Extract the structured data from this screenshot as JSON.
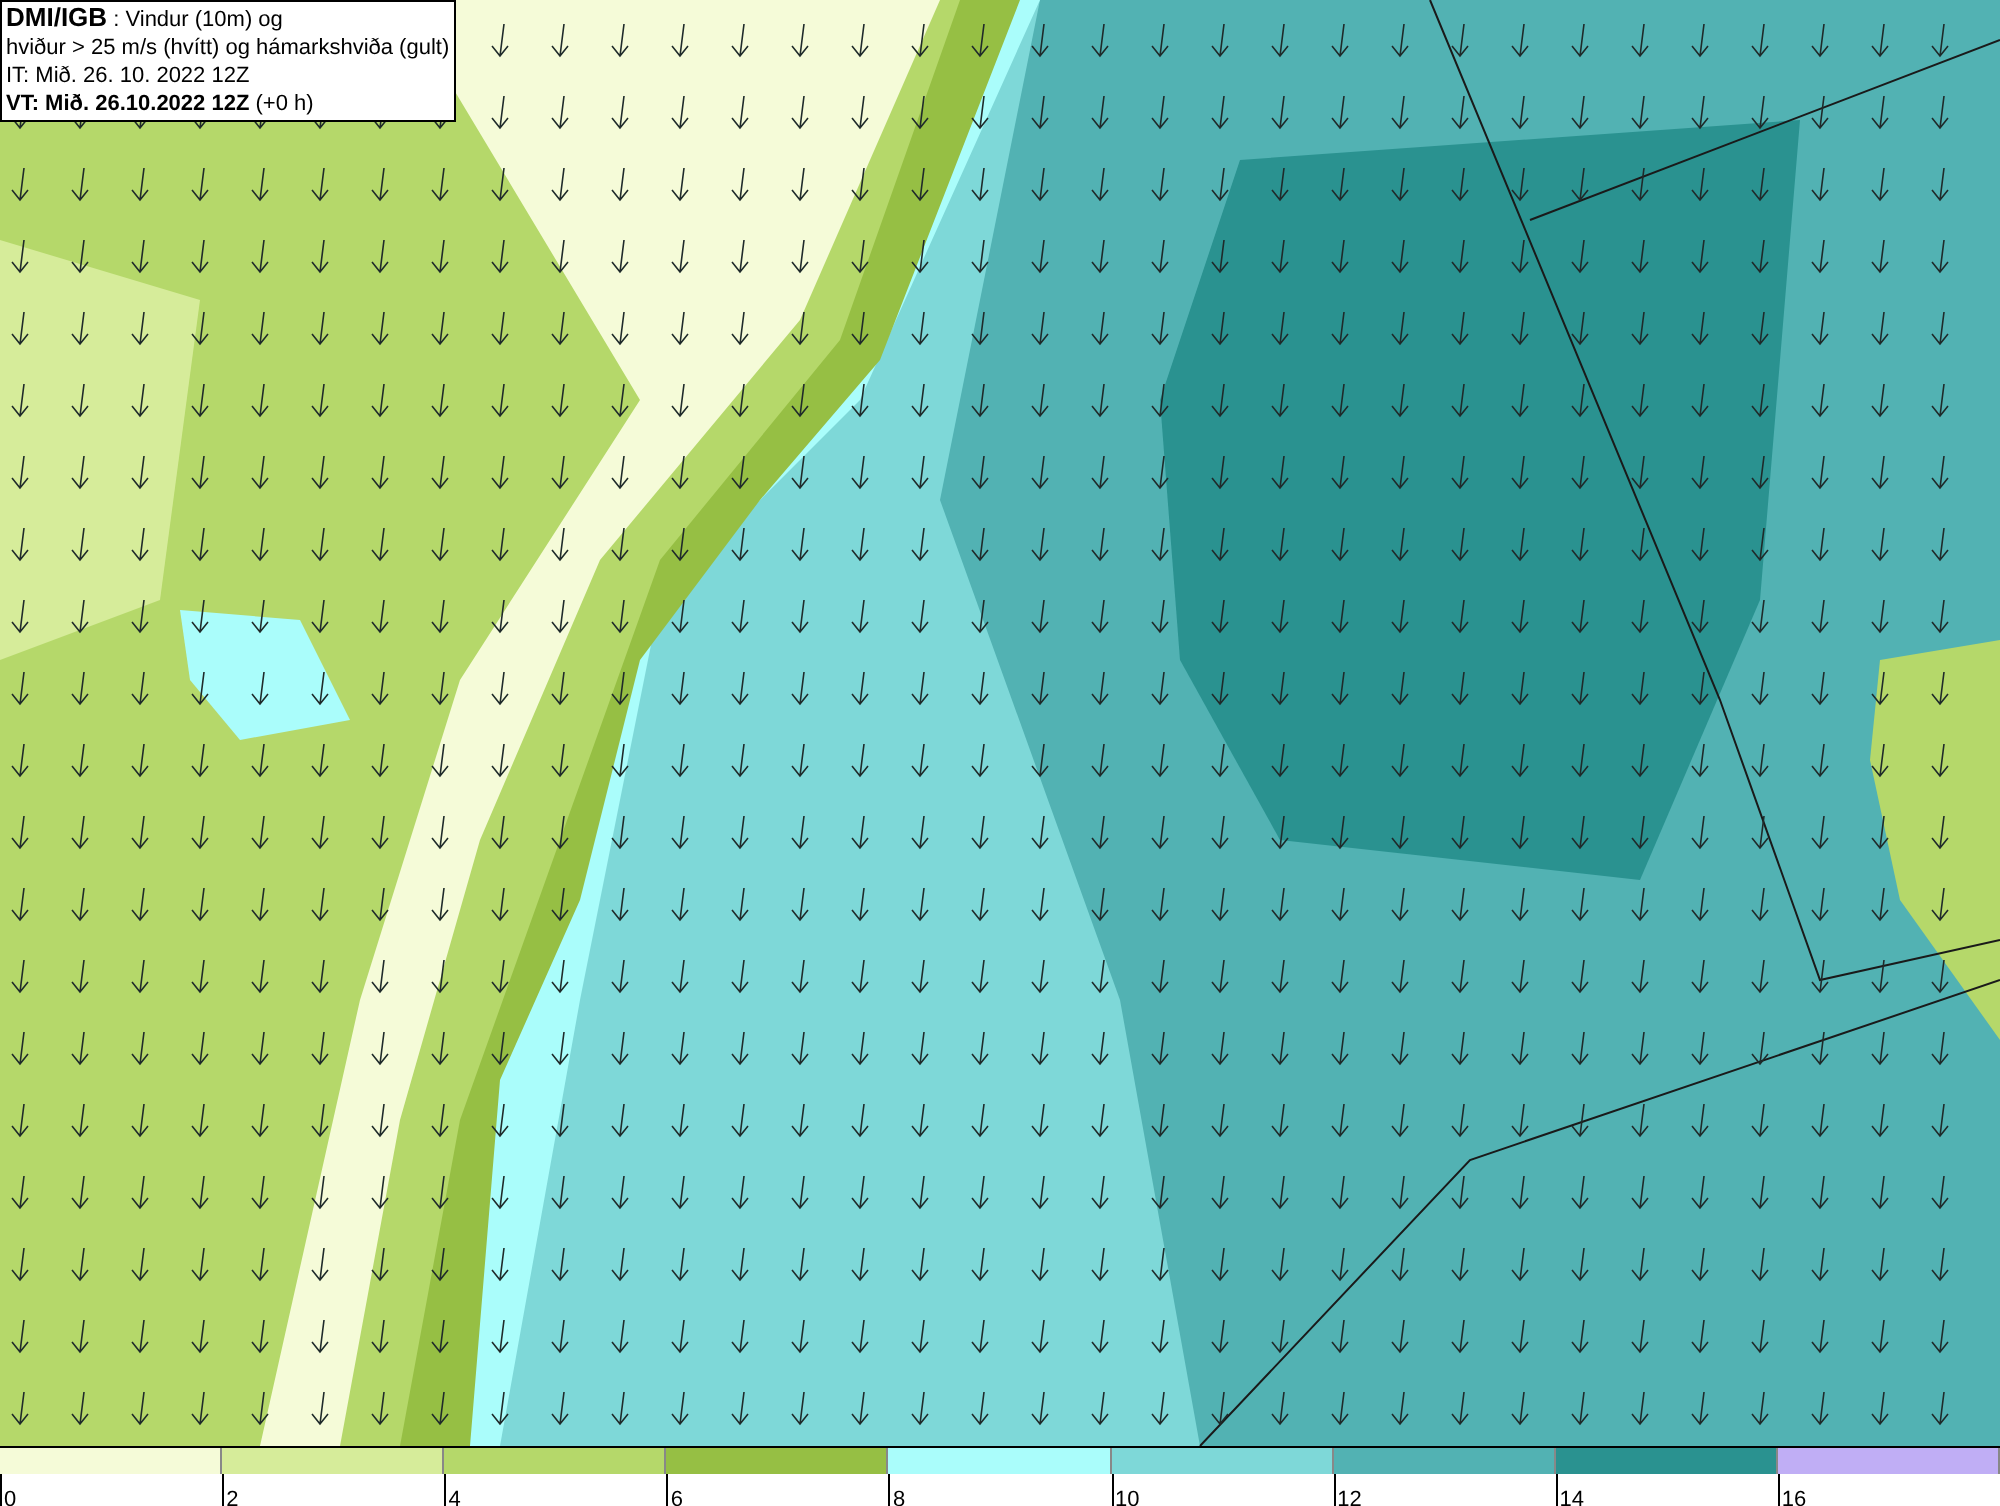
{
  "header": {
    "title": "DMI/IGB",
    "subtitle": ": Vindur (10m) og",
    "line_2": "hviður > 25 m/s (hvítt) og hámarkshviða (gult)",
    "issue_time": "IT: Mið. 26. 10. 2022 12Z",
    "valid_time": "VT: Mið. 26.10.2022 12Z",
    "offset": "(+0 h)"
  },
  "legend": [
    {
      "label": "0",
      "color": "#f5fbd8"
    },
    {
      "label": "2",
      "color": "#d6ec9a"
    },
    {
      "label": "4",
      "color": "#b5d86a"
    },
    {
      "label": "6",
      "color": "#96bf44"
    },
    {
      "label": "8",
      "color": "#aafdfb"
    },
    {
      "label": "10",
      "color": "#7ed8d8"
    },
    {
      "label": "12",
      "color": "#52b2b3"
    },
    {
      "label": "14",
      "color": "#2a9290"
    },
    {
      "label": "16",
      "color": "#c0aef5"
    }
  ]
}
